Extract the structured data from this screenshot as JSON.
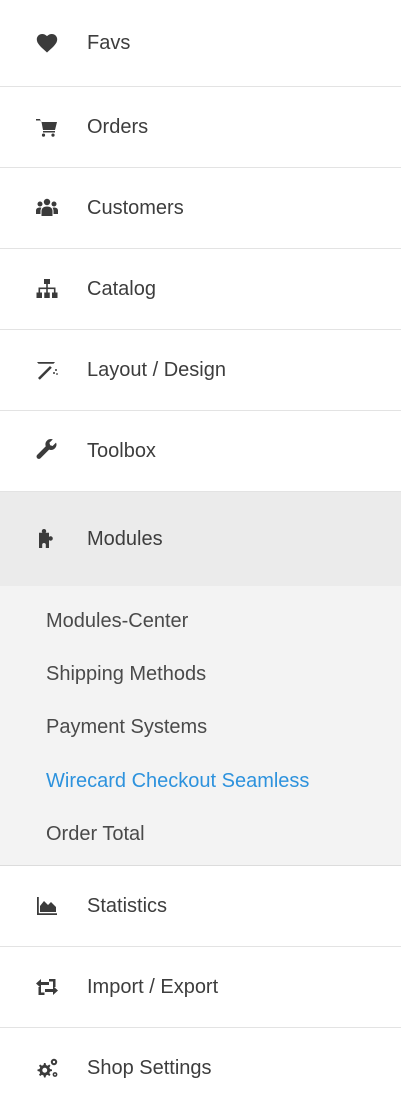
{
  "menu": {
    "items": [
      {
        "label": "Favs",
        "icon": "heart-icon"
      },
      {
        "label": "Orders",
        "icon": "shopping-cart-icon"
      },
      {
        "label": "Customers",
        "icon": "users-icon"
      },
      {
        "label": "Catalog",
        "icon": "sitemap-icon"
      },
      {
        "label": "Layout / Design",
        "icon": "magic-wand-icon"
      },
      {
        "label": "Toolbox",
        "icon": "wrench-icon"
      }
    ],
    "active": {
      "label": "Modules",
      "icon": "puzzle-icon",
      "submenu": [
        {
          "label": "Modules-Center"
        },
        {
          "label": "Shipping Methods"
        },
        {
          "label": "Payment Systems"
        },
        {
          "label": "Wirecard Checkout Seamless"
        },
        {
          "label": "Order Total"
        }
      ]
    },
    "bottom_items": [
      {
        "label": "Statistics",
        "icon": "area-chart-icon"
      },
      {
        "label": "Import / Export",
        "icon": "exchange-icon"
      },
      {
        "label": "Shop Settings",
        "icon": "cogs-icon"
      }
    ]
  },
  "colors": {
    "active_bg": "#ebebeb",
    "submenu_bg": "#f3f3f3",
    "highlight": "#2d92dd",
    "text": "#3d3d3d"
  }
}
